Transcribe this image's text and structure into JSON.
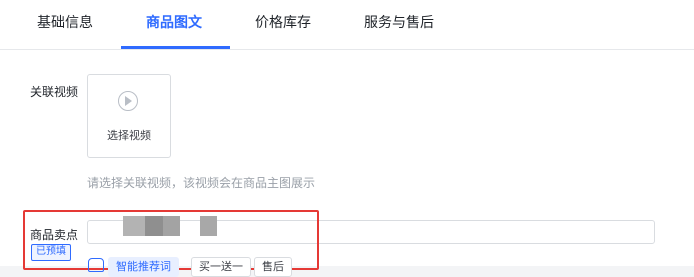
{
  "tabs": [
    {
      "label": "基础信息"
    },
    {
      "label": "商品图文"
    },
    {
      "label": "价格库存"
    },
    {
      "label": "服务与售后"
    }
  ],
  "active_tab": "商品图文",
  "video": {
    "label": "关联视频",
    "upload_text": "选择视频",
    "hint": "请选择关联视频，该视频会在商品主图展示"
  },
  "selling_points": {
    "label": "商品卖点",
    "badge": "已预填",
    "ai_chip": "智能推荐词",
    "chips": [
      "买一送一",
      "售后"
    ]
  },
  "colors": {
    "accent": "#2f6bff",
    "highlight": "#e53935"
  }
}
